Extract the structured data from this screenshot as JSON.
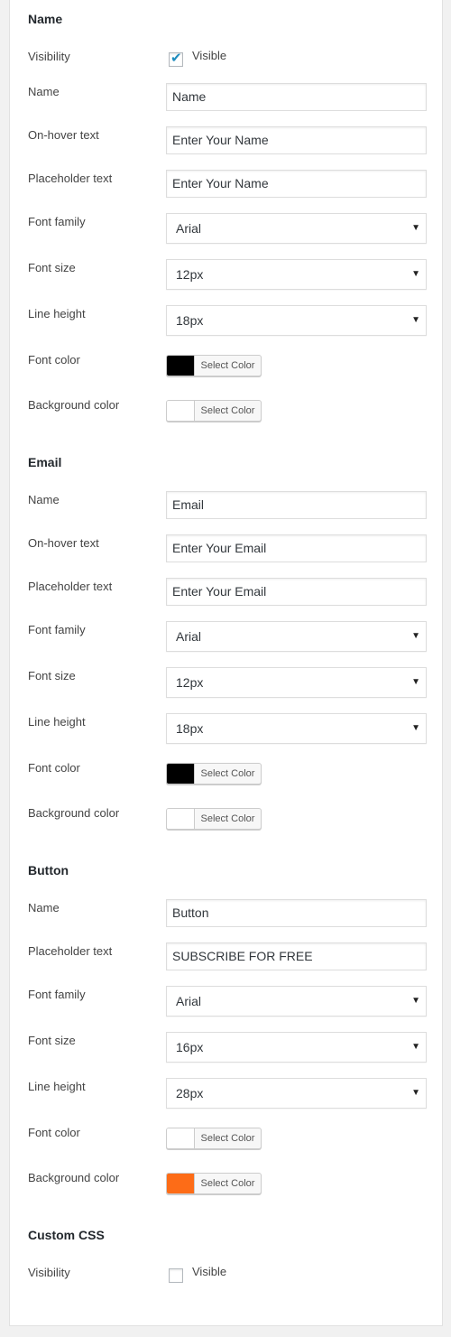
{
  "sections": {
    "name": {
      "title": "Name",
      "visibility_label": "Visibility",
      "visibility_checked": true,
      "visibility_option": "Visible",
      "name_label": "Name",
      "name_value": "Name",
      "hover_label": "On-hover text",
      "hover_value": "Enter Your Name",
      "placeholder_label": "Placeholder text",
      "placeholder_value": "Enter Your Name",
      "font_family_label": "Font family",
      "font_family_value": "Arial",
      "font_size_label": "Font size",
      "font_size_value": "12px",
      "line_height_label": "Line height",
      "line_height_value": "18px",
      "font_color_label": "Font color",
      "font_color": "#000000",
      "bg_color_label": "Background color",
      "bg_color": "#ffffff"
    },
    "email": {
      "title": "Email",
      "name_label": "Name",
      "name_value": "Email",
      "hover_label": "On-hover text",
      "hover_value": "Enter Your Email",
      "placeholder_label": "Placeholder text",
      "placeholder_value": "Enter Your Email",
      "font_family_label": "Font family",
      "font_family_value": "Arial",
      "font_size_label": "Font size",
      "font_size_value": "12px",
      "line_height_label": "Line height",
      "line_height_value": "18px",
      "font_color_label": "Font color",
      "font_color": "#000000",
      "bg_color_label": "Background color",
      "bg_color": "#ffffff"
    },
    "button": {
      "title": "Button",
      "name_label": "Name",
      "name_value": "Button",
      "placeholder_label": "Placeholder text",
      "placeholder_value": "SUBSCRIBE FOR FREE",
      "font_family_label": "Font family",
      "font_family_value": "Arial",
      "font_size_label": "Font size",
      "font_size_value": "16px",
      "line_height_label": "Line height",
      "line_height_value": "28px",
      "font_color_label": "Font color",
      "font_color": "#ffffff",
      "bg_color_label": "Background color",
      "bg_color": "#fd6c17"
    },
    "custom_css": {
      "title": "Custom CSS",
      "visibility_label": "Visibility",
      "visibility_checked": false,
      "visibility_option": "Visible"
    }
  },
  "common": {
    "select_color_label": "Select Color",
    "dropdown_arrow": "▼",
    "check_glyph": "✔"
  }
}
